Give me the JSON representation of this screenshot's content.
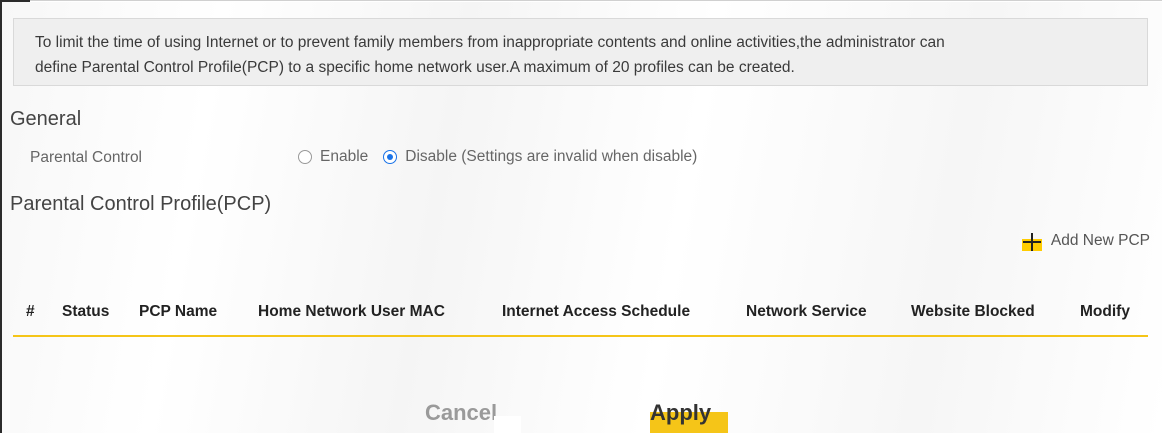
{
  "notice": {
    "line1": "To limit the time of using Internet or to prevent family members from inappropriate contents and online activities,the administrator can",
    "line2": "define Parental Control Profile(PCP) to a specific home network user.A maximum of 20 profiles can be created."
  },
  "general": {
    "heading": "General",
    "parental_control_label": "Parental Control",
    "enable_label": "Enable",
    "disable_label": "Disable (Settings are invalid when disable)",
    "selected": "Disable"
  },
  "pcp": {
    "heading": "Parental Control Profile(PCP)",
    "add_label": "Add New PCP",
    "columns": [
      "#",
      "Status",
      "PCP Name",
      "Home Network User MAC",
      "Internet Access Schedule",
      "Network Service",
      "Website Blocked",
      "Modify"
    ],
    "rows": []
  },
  "buttons": {
    "cancel": "Cancel",
    "apply": "Apply"
  },
  "colors": {
    "accent": "#f5c518",
    "radio": "#1a73e8",
    "notice_bg": "#efefef"
  }
}
